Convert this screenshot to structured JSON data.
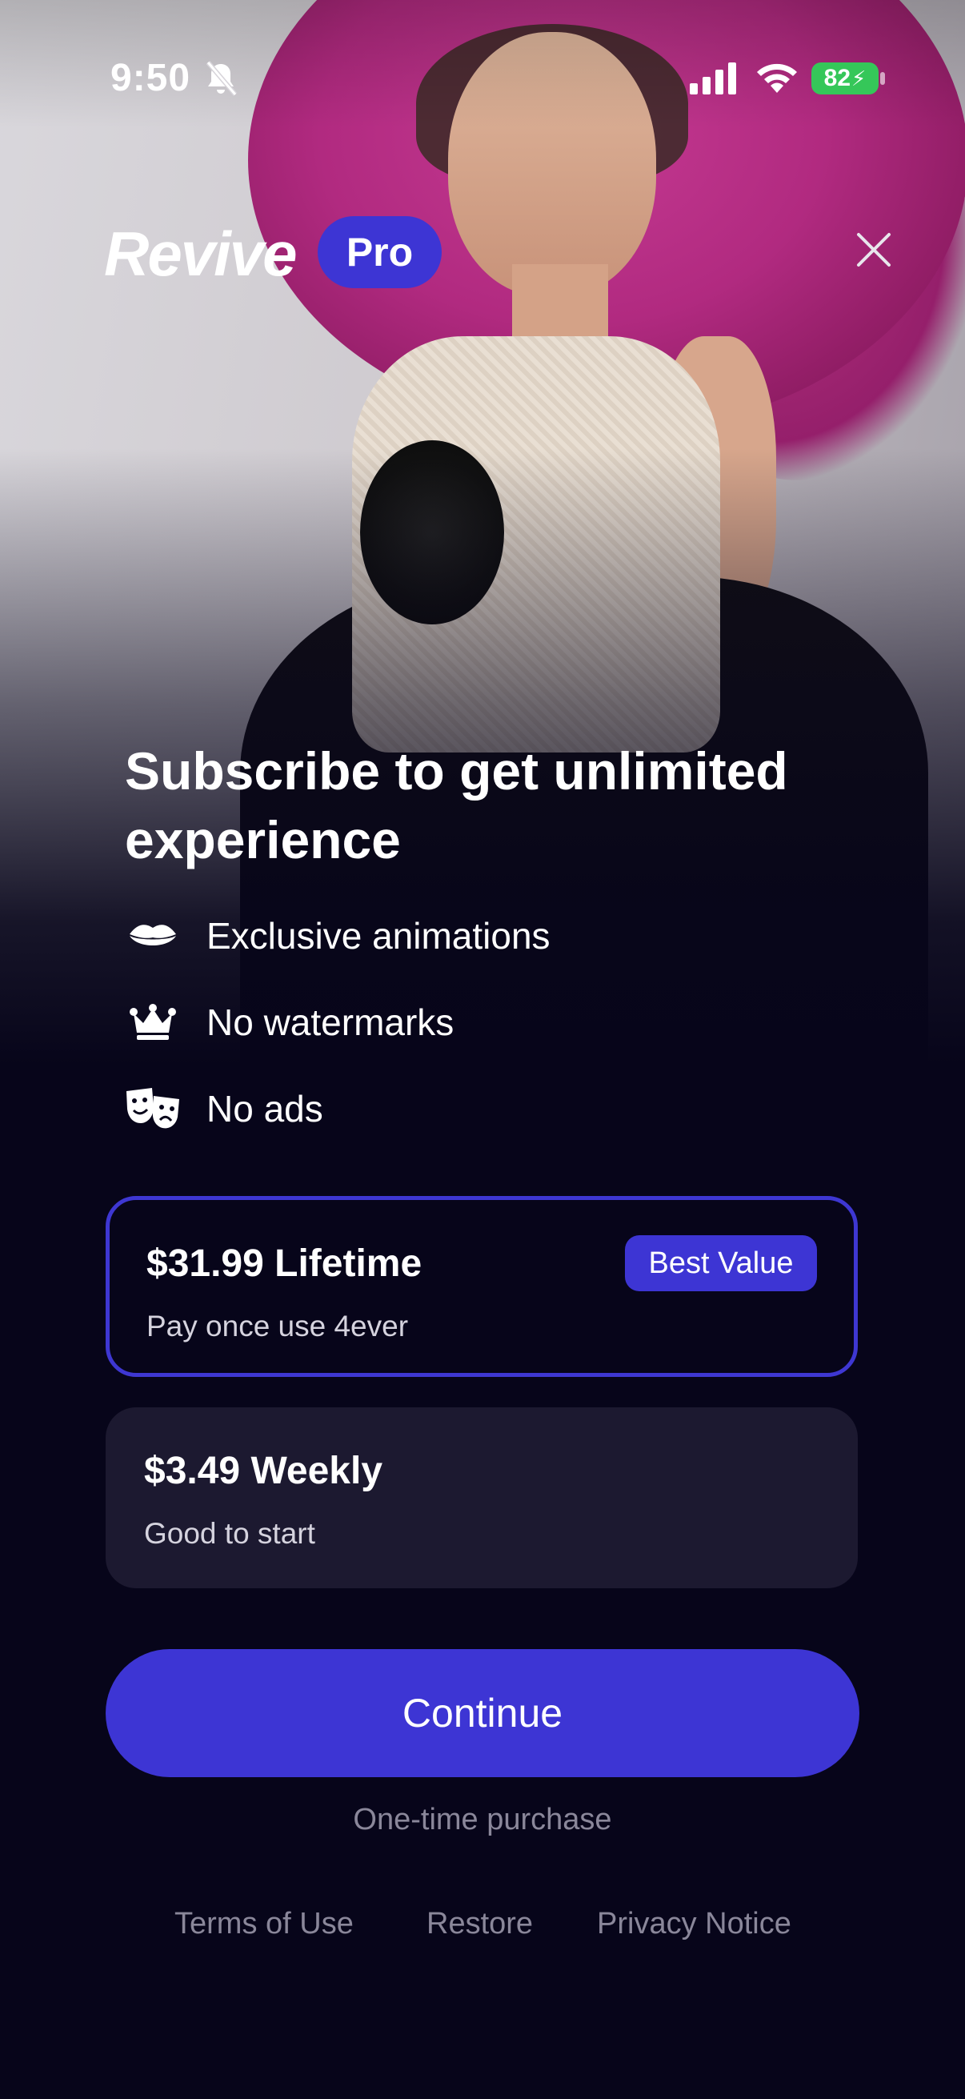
{
  "status_bar": {
    "time": "9:50",
    "battery": "82",
    "icons": [
      "bell-slash-icon",
      "signal-icon",
      "wifi-icon",
      "battery-charging-icon"
    ]
  },
  "header": {
    "logo": "Revive",
    "badge": "Pro",
    "close_icon": "close-icon"
  },
  "headline": "Subscribe to get unlimited experience",
  "features": [
    {
      "icon": "lips-icon",
      "label": "Exclusive animations"
    },
    {
      "icon": "crown-icon",
      "label": "No watermarks"
    },
    {
      "icon": "theater-masks-icon",
      "label": "No ads"
    }
  ],
  "plans": [
    {
      "title": "$31.99 Lifetime",
      "subtitle": "Pay once use 4ever",
      "badge": "Best Value",
      "selected": true
    },
    {
      "title": "$3.49 Weekly",
      "subtitle": "Good to start",
      "selected": false
    }
  ],
  "cta": {
    "label": "Continue",
    "note": "One-time purchase"
  },
  "footer": {
    "terms": "Terms of Use",
    "restore": "Restore",
    "privacy": "Privacy Notice"
  },
  "colors": {
    "background": "#07051a",
    "accent": "#3d35d4",
    "card": "#1c1930",
    "muted_text": "#8a879a"
  }
}
